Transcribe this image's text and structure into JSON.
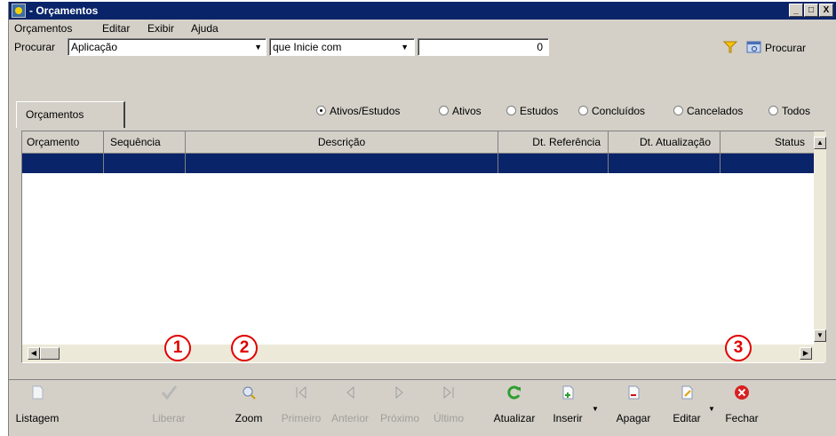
{
  "window": {
    "title": "- Orçamentos",
    "controls": [
      "_",
      "□",
      "X"
    ]
  },
  "menu": [
    "Orçamentos",
    "Editar",
    "Exibir",
    "Ajuda"
  ],
  "search": {
    "label": "Procurar",
    "field_value": "Aplicação",
    "mode_value": "que Inicie com",
    "text_value": "0",
    "procurar_button": "Procurar"
  },
  "tab_label": "Orçamentos",
  "filters": [
    {
      "label": "Ativos/Estudos",
      "checked": true
    },
    {
      "label": "Ativos",
      "checked": false
    },
    {
      "label": "Estudos",
      "checked": false
    },
    {
      "label": "Concluídos",
      "checked": false
    },
    {
      "label": "Cancelados",
      "checked": false
    },
    {
      "label": "Todos",
      "checked": false
    }
  ],
  "grid": {
    "columns": [
      "Orçamento",
      "Sequência",
      "Descrição",
      "Dt. Referência",
      "Dt. Atualização",
      "Status"
    ],
    "selected_row_color": "#0a246a"
  },
  "toolbar": [
    {
      "label": "Listagem",
      "icon": "document-icon",
      "enabled": true
    },
    {
      "label": "Liberar",
      "icon": "check-icon",
      "enabled": false
    },
    {
      "label": "Zoom",
      "icon": "zoom-icon",
      "enabled": true
    },
    {
      "label": "Primeiro",
      "icon": "first-icon",
      "enabled": false
    },
    {
      "label": "Anterior",
      "icon": "previous-icon",
      "enabled": false
    },
    {
      "label": "Próximo",
      "icon": "next-icon",
      "enabled": false
    },
    {
      "label": "Último",
      "icon": "last-icon",
      "enabled": false
    },
    {
      "label": "Atualizar",
      "icon": "refresh-icon",
      "enabled": true
    },
    {
      "label": "Inserir",
      "icon": "insert-icon",
      "enabled": true
    },
    {
      "label": "Apagar",
      "icon": "delete-icon",
      "enabled": true
    },
    {
      "label": "Editar",
      "icon": "edit-icon",
      "enabled": true
    },
    {
      "label": "Fechar",
      "icon": "close-icon",
      "enabled": true
    }
  ],
  "markers": [
    "1",
    "2",
    "3"
  ],
  "colors": {
    "titlebar": "#0a246a",
    "marker": "#e00000",
    "window": "#d4d0c8"
  }
}
